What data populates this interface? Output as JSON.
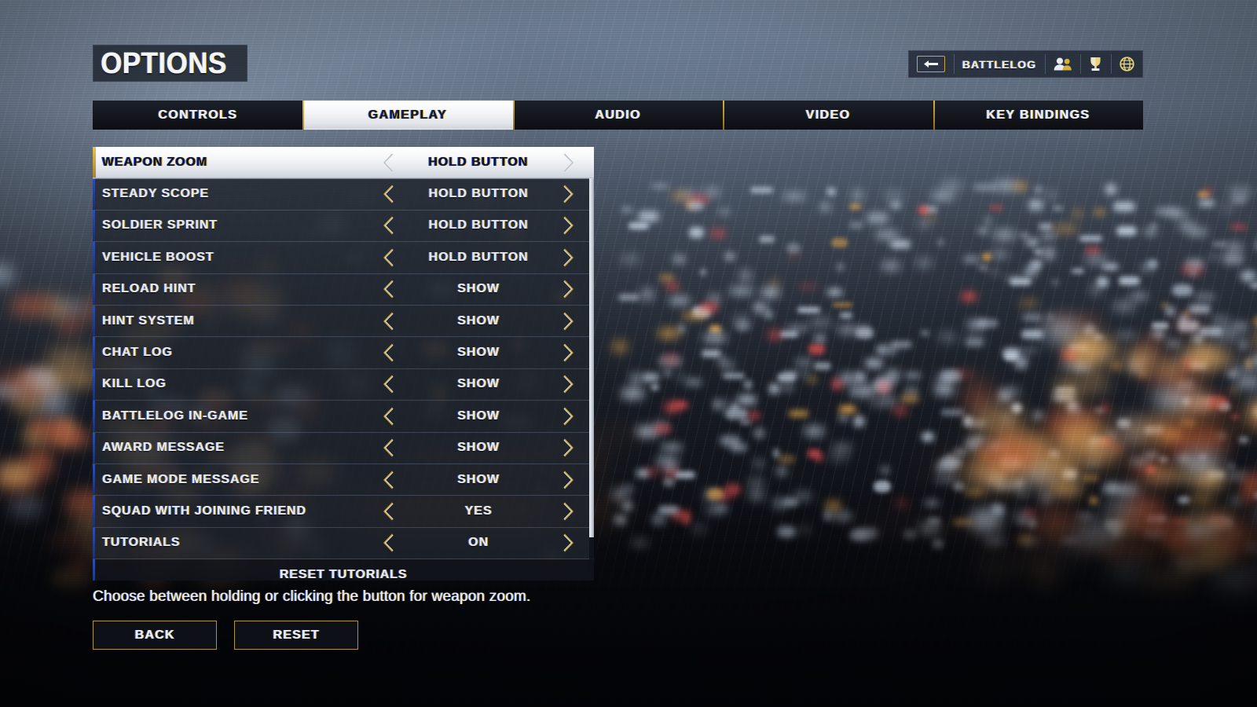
{
  "page": {
    "title": "OPTIONS"
  },
  "toolbar": {
    "back_icon": "back-arrow-icon",
    "battlelog_label": "BATTLELOG",
    "friends_icon": "friends-icon",
    "awards_icon": "trophy-icon",
    "globe_icon": "globe-icon"
  },
  "tabs": [
    {
      "label": "CONTROLS",
      "active": false
    },
    {
      "label": "GAMEPLAY",
      "active": true
    },
    {
      "label": "AUDIO",
      "active": false
    },
    {
      "label": "VIDEO",
      "active": false
    },
    {
      "label": "KEY BINDINGS",
      "active": false
    }
  ],
  "options": [
    {
      "name": "WEAPON ZOOM",
      "value": "HOLD BUTTON",
      "selected": true
    },
    {
      "name": "STEADY SCOPE",
      "value": "HOLD BUTTON",
      "selected": false
    },
    {
      "name": "SOLDIER SPRINT",
      "value": "HOLD BUTTON",
      "selected": false
    },
    {
      "name": "VEHICLE BOOST",
      "value": "HOLD BUTTON",
      "selected": false
    },
    {
      "name": "RELOAD HINT",
      "value": "SHOW",
      "selected": false
    },
    {
      "name": "HINT SYSTEM",
      "value": "SHOW",
      "selected": false
    },
    {
      "name": "CHAT LOG",
      "value": "SHOW",
      "selected": false
    },
    {
      "name": "KILL LOG",
      "value": "SHOW",
      "selected": false
    },
    {
      "name": "BATTLELOG IN-GAME",
      "value": "SHOW",
      "selected": false
    },
    {
      "name": "AWARD MESSAGE",
      "value": "SHOW",
      "selected": false
    },
    {
      "name": "GAME MODE MESSAGE",
      "value": "SHOW",
      "selected": false
    },
    {
      "name": "SQUAD WITH JOINING FRIEND",
      "value": "YES",
      "selected": false
    },
    {
      "name": "TUTORIALS",
      "value": "ON",
      "selected": false
    }
  ],
  "list_action": {
    "label": "RESET TUTORIALS"
  },
  "description": "Choose between holding or clicking the button for weapon zoom.",
  "buttons": [
    {
      "label": "BACK"
    },
    {
      "label": "RESET"
    }
  ],
  "colors": {
    "accent_gold": "#c9a53a",
    "accent_blue": "#3457c4",
    "selected_row_text": "#0b1229",
    "row_text": "#e6eaf2",
    "row_bg": "#212630",
    "tab_bg": "#0d1016"
  },
  "scroll": {
    "thumb_fraction": 0.9
  }
}
